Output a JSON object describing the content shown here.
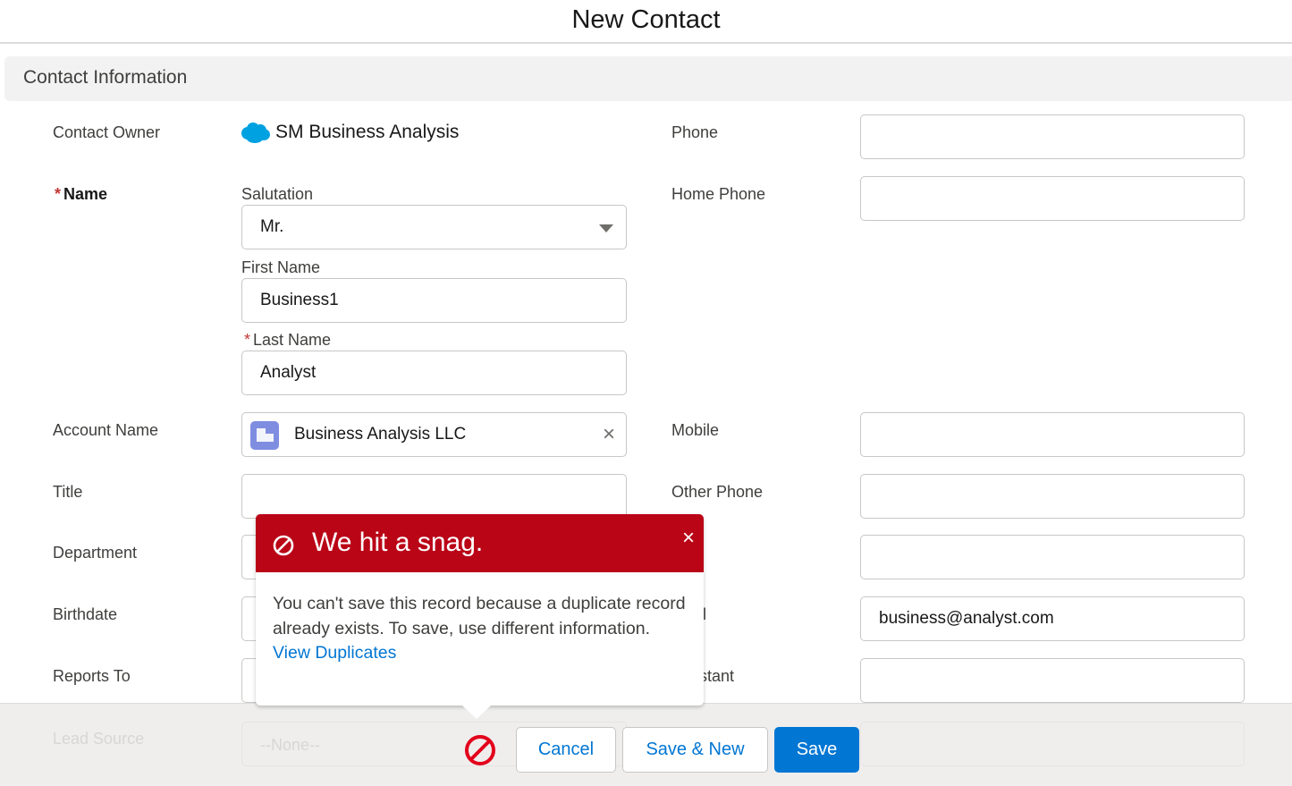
{
  "modal": {
    "title": "New Contact"
  },
  "section": {
    "title": "Contact Information"
  },
  "left": {
    "contact_owner": {
      "label": "Contact Owner",
      "value": "SM Business Analysis",
      "icon": "salesforce-cloud-icon"
    },
    "name": {
      "label": "Name",
      "required_marker": "*",
      "salutation": {
        "label": "Salutation",
        "value": "Mr."
      },
      "first_name": {
        "label": "First Name",
        "value": "Business1"
      },
      "last_name": {
        "label": "Last Name",
        "value": "Analyst",
        "required_marker": "*"
      }
    },
    "account_name": {
      "label": "Account Name",
      "value": "Business Analysis LLC",
      "icon": "account-building-icon",
      "clear_icon": "×"
    },
    "title": {
      "label": "Title",
      "value": ""
    },
    "department": {
      "label": "Department",
      "value": ""
    },
    "birthdate": {
      "label": "Birthdate",
      "value": ""
    },
    "reports_to": {
      "label": "Reports To",
      "value": ""
    },
    "lead_source": {
      "label": "Lead Source",
      "value": "--None--"
    }
  },
  "right": {
    "phone": {
      "label": "Phone",
      "value": ""
    },
    "home_phone": {
      "label": "Home Phone",
      "value": ""
    },
    "mobile": {
      "label": "Mobile",
      "value": ""
    },
    "other_phone": {
      "label": "Other Phone",
      "value": ""
    },
    "fax": {
      "label_visible_fragment": "",
      "value": ""
    },
    "email": {
      "label_visible_fragment": "il",
      "value": "business@analyst.com"
    },
    "assistant": {
      "label_visible_fragment": "stant",
      "value": ""
    }
  },
  "error_popover": {
    "title": "We hit a snag.",
    "close_icon": "×",
    "message": "You can't save this record because a duplicate record already exists. To save, use different information.",
    "link": "View Duplicates"
  },
  "footer": {
    "cancel_label": "Cancel",
    "save_new_label": "Save & New",
    "save_label": "Save"
  },
  "colors": {
    "brand": "#0176d3",
    "error": "#ba0517",
    "required": "#c23934",
    "account_icon": "#7f8de1",
    "salesforce_cloud": "#00a1e0"
  }
}
